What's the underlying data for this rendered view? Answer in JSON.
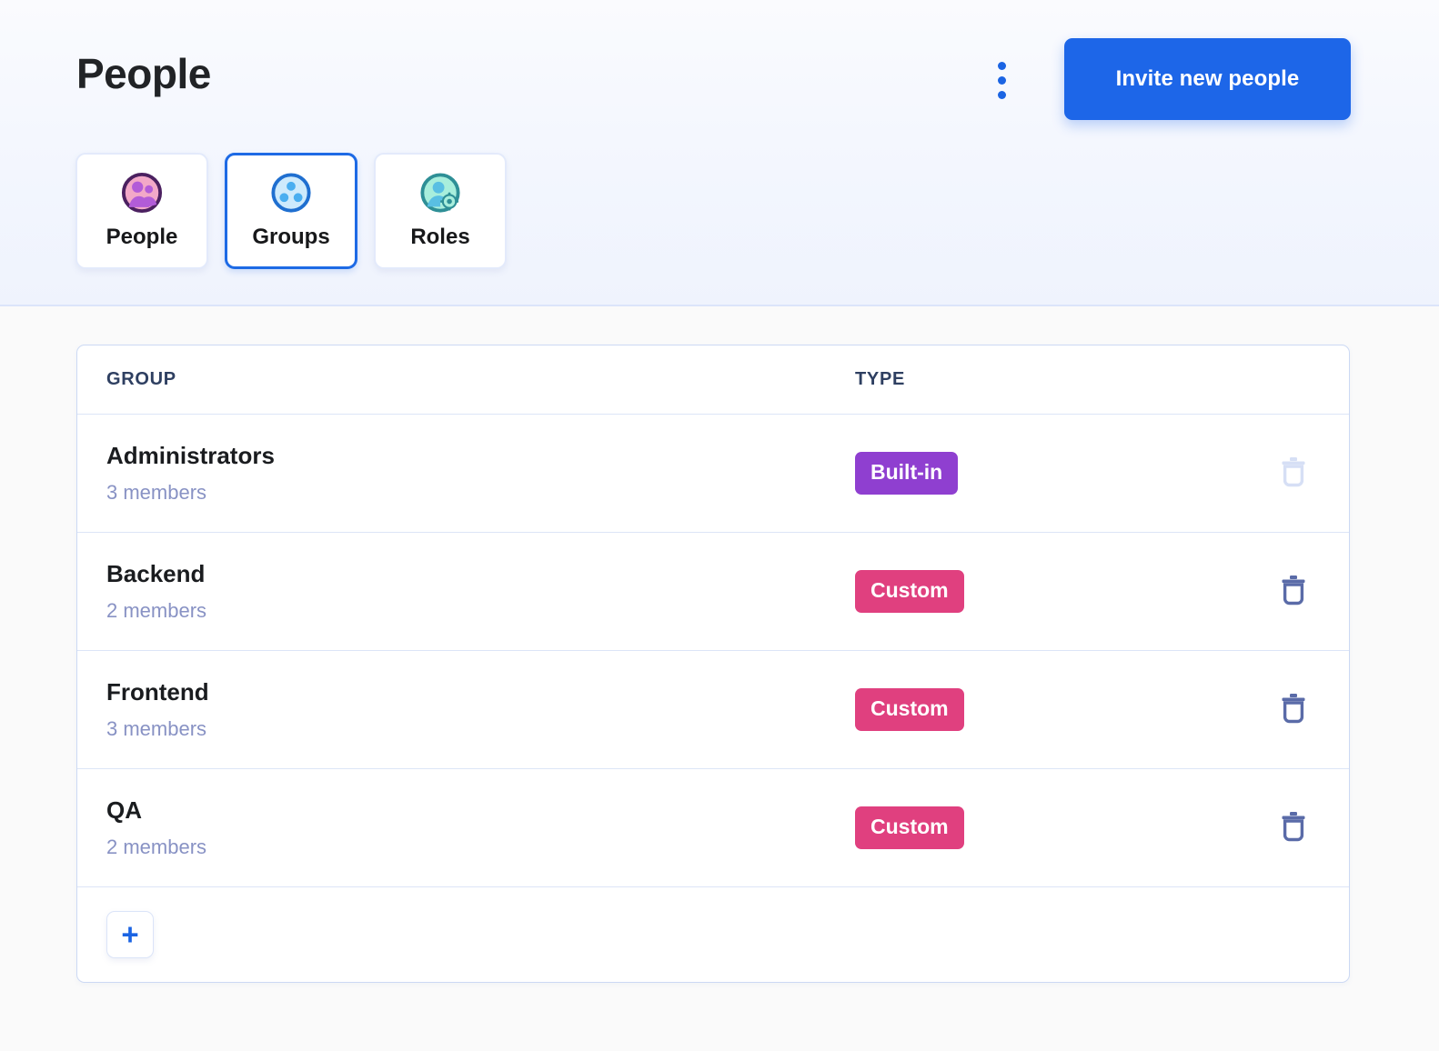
{
  "header": {
    "title": "People",
    "kebab_icon": "kebab-menu-icon",
    "invite_label": "Invite new people",
    "accent_color": "#1d66e8"
  },
  "tabs": [
    {
      "label": "People",
      "icon": "people-group-icon",
      "selected": false
    },
    {
      "label": "Groups",
      "icon": "three-dots-circle-icon",
      "selected": true
    },
    {
      "label": "Roles",
      "icon": "person-gear-icon",
      "selected": false
    }
  ],
  "table": {
    "columns": {
      "group": "GROUP",
      "type": "TYPE"
    },
    "rows": [
      {
        "name": "Administrators",
        "members": "3 members",
        "type": "Built-in",
        "type_style": "builtin",
        "delete_enabled": false,
        "delete_icon": "trash-icon"
      },
      {
        "name": "Backend",
        "members": "2 members",
        "type": "Custom",
        "type_style": "custom",
        "delete_enabled": true,
        "delete_icon": "trash-icon"
      },
      {
        "name": "Frontend",
        "members": "3 members",
        "type": "Custom",
        "type_style": "custom",
        "delete_enabled": true,
        "delete_icon": "trash-icon"
      },
      {
        "name": "QA",
        "members": "2 members",
        "type": "Custom",
        "type_style": "custom",
        "delete_enabled": true,
        "delete_icon": "trash-icon"
      }
    ],
    "add_label": "+",
    "add_icon": "plus-icon"
  },
  "colors": {
    "badge_builtin": "#8f3fd0",
    "badge_custom": "#e0407f",
    "trash_active": "#5a6ba8",
    "trash_disabled": "#d6dff5",
    "header_band": "#eff3fd"
  }
}
